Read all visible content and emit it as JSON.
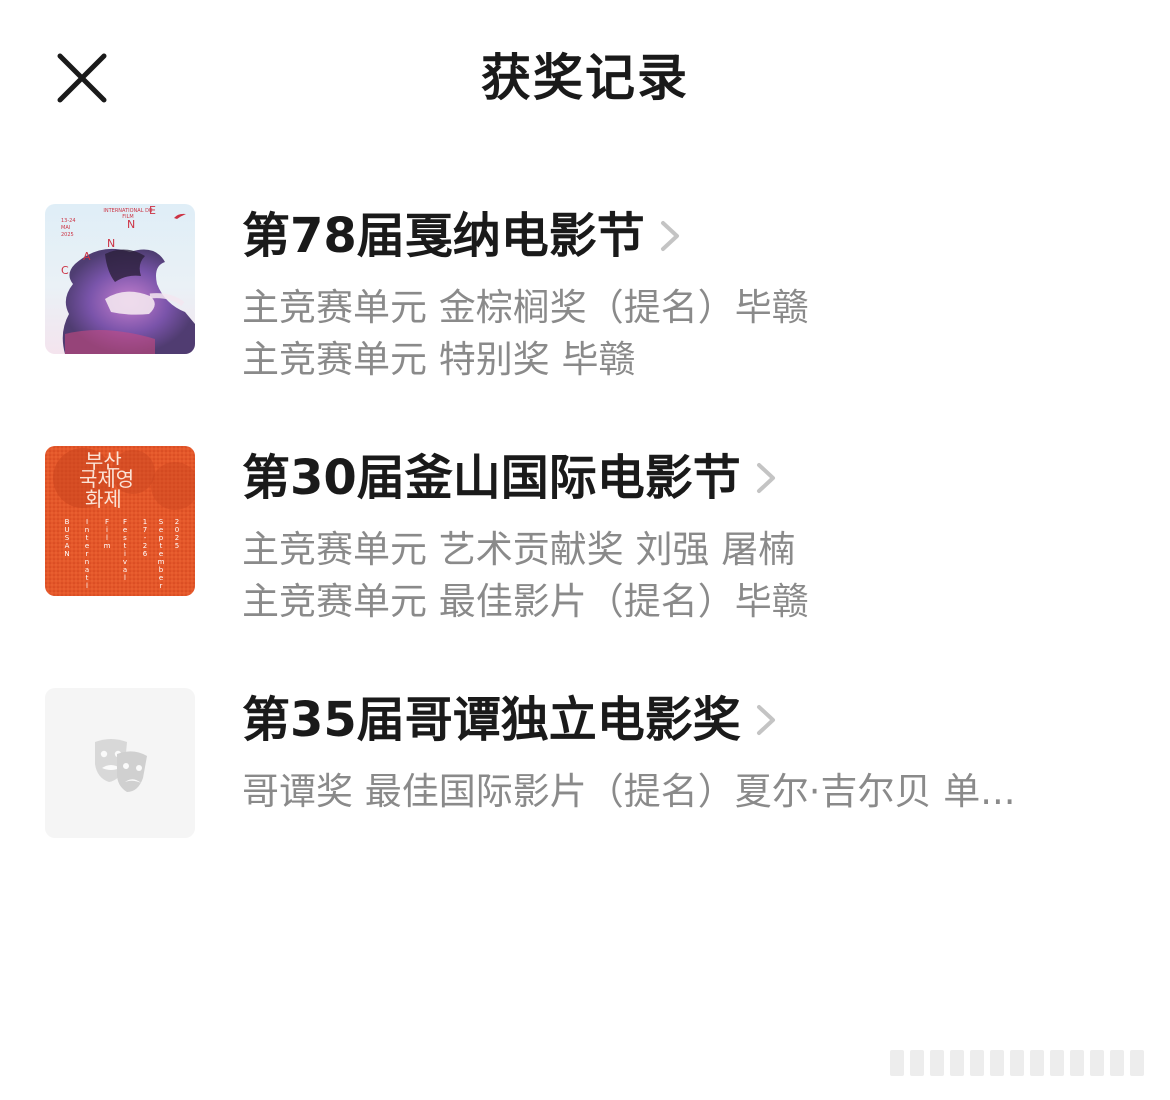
{
  "header": {
    "title": "获奖记录"
  },
  "awards": [
    {
      "festival": "第78届戛纳电影节",
      "lines": [
        "主竞赛单元 金棕榈奖（提名）毕赣",
        "主竞赛单元 特别奖 毕赣"
      ],
      "poster": {
        "type": "cannes",
        "text_top": "INTERNATIONAL DU FILM",
        "dates": "13-24 MAI 2025",
        "letters": [
          "C",
          "A",
          "N",
          "N",
          "E"
        ]
      }
    },
    {
      "festival": "第30届釜山国际电影节",
      "lines": [
        "主竞赛单元  艺术贡献奖 刘强 屠楠",
        "主竞赛单元  最佳影片（提名）毕赣"
      ],
      "poster": {
        "type": "busan",
        "korean": [
          "부산",
          "국제영",
          "화제"
        ],
        "columns": [
          "BUSAN",
          "Internatl",
          "Film",
          "Festival",
          "17-26",
          "September",
          "2025"
        ]
      }
    },
    {
      "festival": "第35届哥谭独立电影奖",
      "lines": [
        "哥谭奖 最佳国际影片（提名）夏尔·吉尔贝 单..."
      ],
      "poster": {
        "type": "placeholder",
        "icon": "theater-masks-icon"
      }
    }
  ],
  "colors": {
    "title": "#1a1a1a",
    "secondary": "#8a8a8a",
    "chevron": "#c4c4c4",
    "placeholder_bg": "#f5f5f5",
    "busan_orange": "#e85a2a"
  }
}
